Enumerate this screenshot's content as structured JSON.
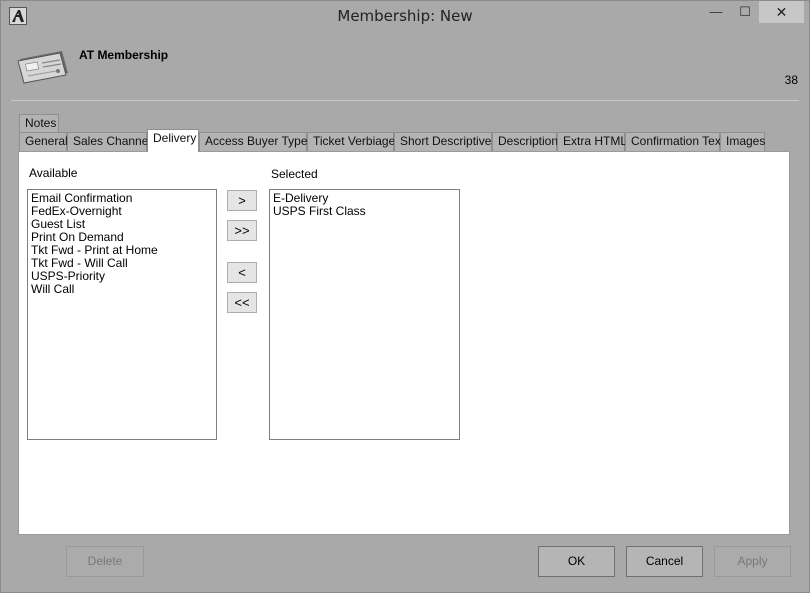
{
  "window": {
    "title": "Membership: New",
    "minimize_glyph": "—",
    "maximize_glyph": "☐",
    "close_glyph": "✕"
  },
  "header": {
    "title": "AT Membership",
    "count": "38",
    "icon": "membership-card-icon"
  },
  "tabs_row1": [
    {
      "label": "Notes"
    }
  ],
  "tabs_row2": [
    {
      "label": "General"
    },
    {
      "label": "Sales Channel"
    },
    {
      "label": "Delivery",
      "active": true
    },
    {
      "label": "Access Buyer Types"
    },
    {
      "label": "Ticket Verbiage"
    },
    {
      "label": "Short Descriptives"
    },
    {
      "label": "Description"
    },
    {
      "label": "Extra HTML"
    },
    {
      "label": "Confirmation Text"
    },
    {
      "label": "Images"
    }
  ],
  "delivery": {
    "available_label": "Available",
    "selected_label": "Selected",
    "available_items": [
      "Email Confirmation",
      "FedEx-Overnight",
      "Guest List",
      "Print On Demand",
      "Tkt Fwd - Print at Home",
      "Tkt Fwd - Will Call",
      "USPS-Priority",
      "Will Call"
    ],
    "selected_items": [
      "E-Delivery",
      "USPS First Class"
    ],
    "move_right": ">",
    "move_all_right": ">>",
    "move_left": "<",
    "move_all_left": "<<"
  },
  "footer": {
    "delete": "Delete",
    "ok": "OK",
    "cancel": "Cancel",
    "apply": "Apply"
  }
}
